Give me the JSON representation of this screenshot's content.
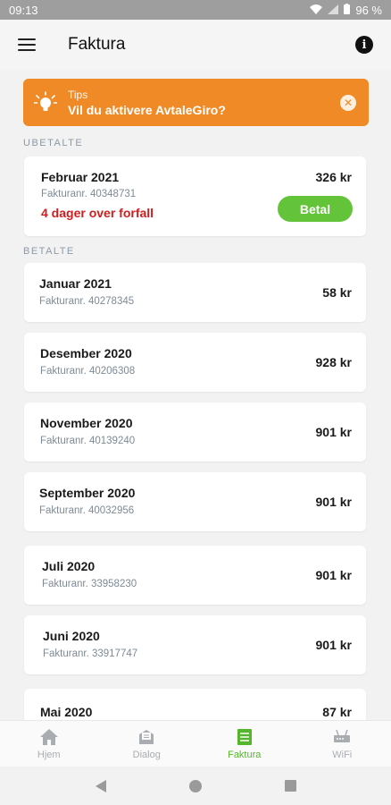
{
  "statusbar": {
    "time": "09:13",
    "battery": "96 %"
  },
  "appbar": {
    "title": "Faktura"
  },
  "tips": {
    "label": "Tips",
    "message": "Vil du aktivere AvtaleGiro?"
  },
  "sections": {
    "unpaid": "UBETALTE",
    "paid": "BETALTE"
  },
  "unpaid": {
    "month": "Februar 2021",
    "invoice": "Fakturanr. 40348731",
    "amount": "326 kr",
    "overdue": "4 dager over forfall",
    "pay_label": "Betal"
  },
  "paid": [
    {
      "month": "Januar 2021",
      "invoice": "Fakturanr. 40278345",
      "amount": "58 kr"
    },
    {
      "month": "Desember 2020",
      "invoice": "Fakturanr. 40206308",
      "amount": "928 kr"
    },
    {
      "month": "November 2020",
      "invoice": "Fakturanr. 40139240",
      "amount": "901 kr"
    },
    {
      "month": "September 2020",
      "invoice": "Fakturanr. 40032956",
      "amount": "901 kr"
    },
    {
      "month": "Juli 2020",
      "invoice": "Fakturanr. 33958230",
      "amount": "901 kr"
    },
    {
      "month": "Juni 2020",
      "invoice": "Fakturanr. 33917747",
      "amount": "901 kr"
    },
    {
      "month": "Mai 2020",
      "invoice": "",
      "amount": "87 kr"
    }
  ],
  "nav": [
    {
      "label": "Hjem",
      "icon": "home-icon"
    },
    {
      "label": "Dialog",
      "icon": "dialog-icon"
    },
    {
      "label": "Faktura",
      "icon": "invoice-icon"
    },
    {
      "label": "WiFi",
      "icon": "router-icon"
    }
  ],
  "colors": {
    "accent": "#ef8a26",
    "primary": "#63c43a",
    "overdue": "#d11d1d"
  }
}
